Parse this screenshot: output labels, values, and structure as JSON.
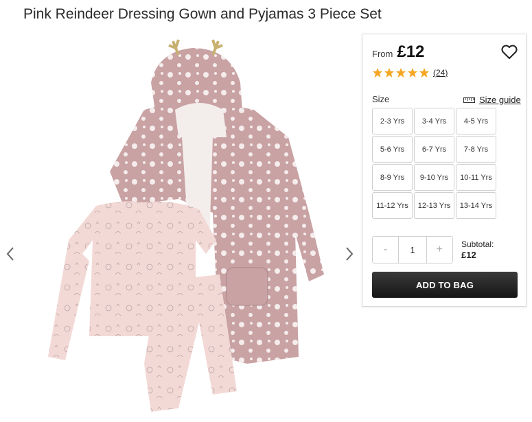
{
  "product": {
    "title": "Pink Reindeer Dressing Gown and Pyjamas 3 Piece Set"
  },
  "gallery": {
    "prev_icon": "chevron-left-icon",
    "next_icon": "chevron-right-icon"
  },
  "price": {
    "from_label": "From",
    "value": "£12"
  },
  "wishlist": {
    "icon": "heart-outline-icon"
  },
  "rating": {
    "stars": 5,
    "count": "(24)",
    "star_color": "#f5a623"
  },
  "size": {
    "label": "Size",
    "guide_label": "Size guide",
    "guide_icon": "ruler-icon",
    "options": [
      "2-3 Yrs",
      "3-4 Yrs",
      "4-5 Yrs",
      "5-6 Yrs",
      "6-7 Yrs",
      "7-8 Yrs",
      "8-9 Yrs",
      "9-10 Yrs",
      "10-11 Yrs",
      "11-12 Yrs",
      "12-13 Yrs",
      "13-14 Yrs"
    ]
  },
  "quantity": {
    "minus": "-",
    "value": "1",
    "plus": "+"
  },
  "subtotal": {
    "label": "Subtotal:",
    "amount": "£12"
  },
  "cta": {
    "add_to_bag": "ADD TO BAG"
  },
  "colors": {
    "gown_pink": "#c9a2a4",
    "pyjama_pink": "#f3d9d6",
    "button_dark": "#1e1e1e"
  }
}
